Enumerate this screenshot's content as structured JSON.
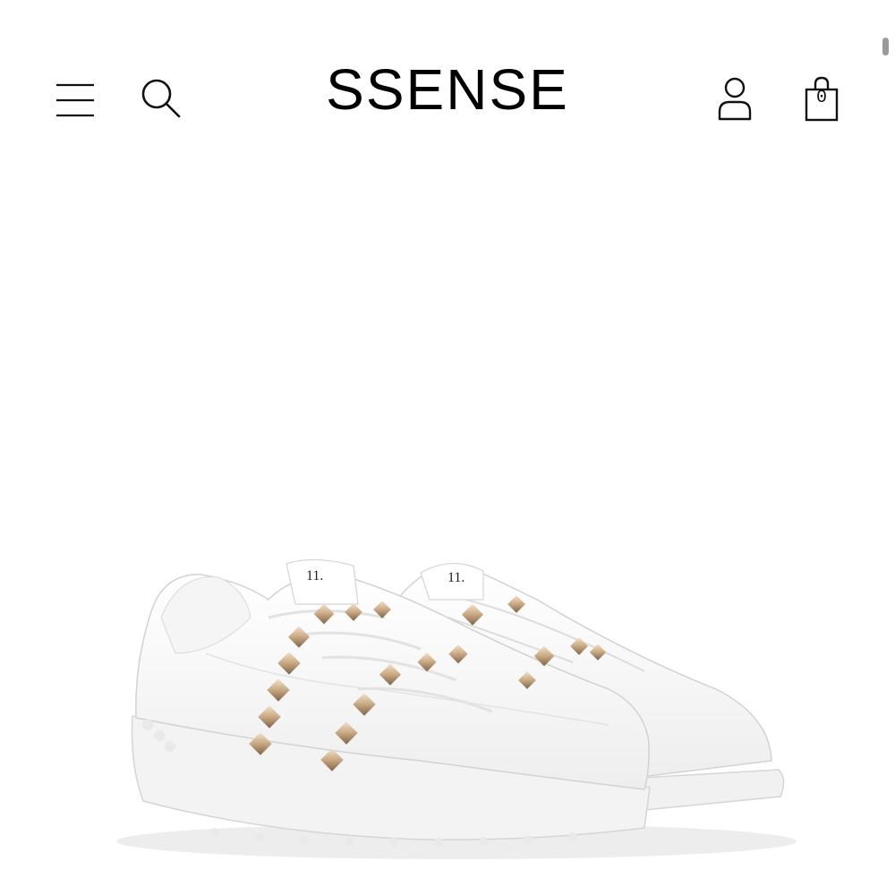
{
  "header": {
    "logo": "SSENSE",
    "menu_icon": "hamburger-menu-icon",
    "search_icon": "search-icon",
    "account_icon": "user-icon",
    "bag_icon": "shopping-bag-icon",
    "bag_count": "0"
  },
  "product": {
    "image_icon": "white-studded-sneakers-image",
    "stud_color": "#c8a882",
    "shoe_color": "#ffffff",
    "tongue_label": "11."
  },
  "colors": {
    "background": "#ffffff",
    "text": "#111111",
    "scroll_indicator": "#9a9a9a"
  }
}
